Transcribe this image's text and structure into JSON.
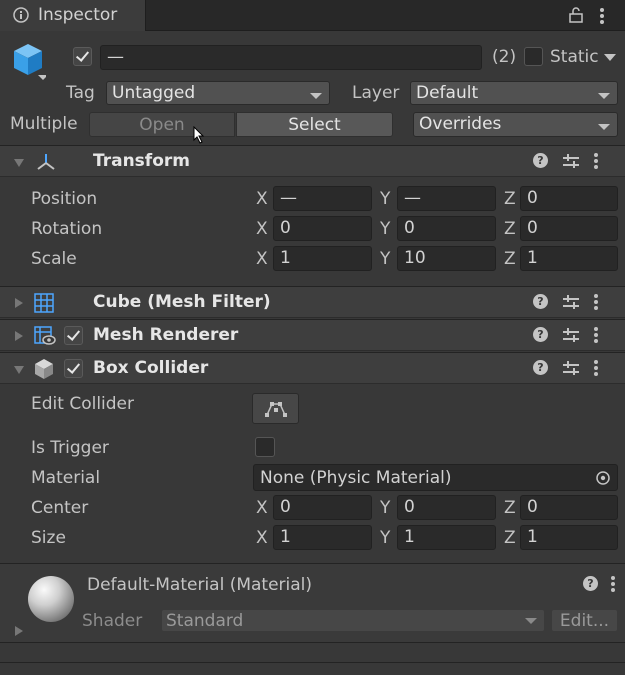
{
  "window": {
    "tab_title": "Inspector"
  },
  "header": {
    "name_value": "—",
    "count": "(2)",
    "static_label": "Static",
    "tag_label": "Tag",
    "tag_value": "Untagged",
    "layer_label": "Layer",
    "layer_value": "Default",
    "multiple_label": "Multiple",
    "open_label": "Open",
    "select_label": "Select",
    "overrides_label": "Overrides"
  },
  "transform": {
    "title": "Transform",
    "rows": [
      {
        "label": "Position",
        "x": "—",
        "y": "—",
        "z": "0"
      },
      {
        "label": "Rotation",
        "x": "0",
        "y": "0",
        "z": "0"
      },
      {
        "label": "Scale",
        "x": "1",
        "y": "10",
        "z": "1"
      }
    ]
  },
  "axes": {
    "x": "X",
    "y": "Y",
    "z": "Z"
  },
  "mesh_filter": {
    "title": "Cube (Mesh Filter)"
  },
  "mesh_renderer": {
    "title": "Mesh Renderer"
  },
  "box_collider": {
    "title": "Box Collider",
    "edit_collider_label": "Edit Collider",
    "is_trigger_label": "Is Trigger",
    "material_label": "Material",
    "material_value": "None (Physic Material)",
    "center_label": "Center",
    "center": {
      "x": "0",
      "y": "0",
      "z": "0"
    },
    "size_label": "Size",
    "size": {
      "x": "1",
      "y": "1",
      "z": "1"
    }
  },
  "material": {
    "title": "Default-Material (Material)",
    "shader_label": "Shader",
    "shader_value": "Standard",
    "edit_label": "Edit..."
  },
  "colors": {
    "background": "#383838",
    "header": "#3e3e3e",
    "field": "#2a2a2a",
    "cube_icon": "#3aa0e8"
  }
}
